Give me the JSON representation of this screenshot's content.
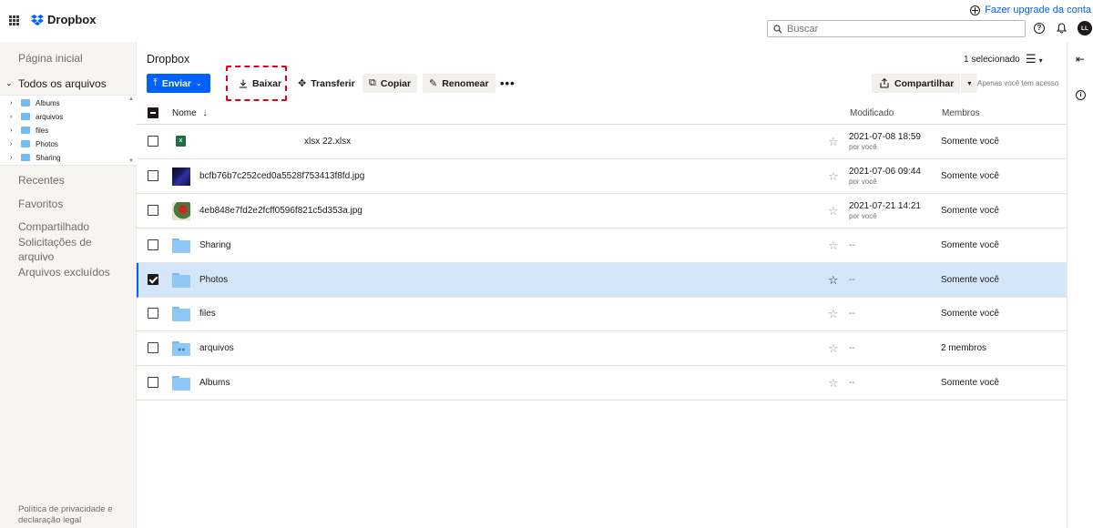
{
  "header": {
    "brand": "Dropbox",
    "upgrade_label": "Fazer upgrade da conta",
    "search_placeholder": "Buscar",
    "avatar_initials": "LL",
    "help_glyph": "?",
    "accent_color": "#0061fe"
  },
  "sidebar": {
    "home": "Página inicial",
    "all_files": "Todos os arquivos",
    "tree": [
      {
        "label": "Albums",
        "icon": "folder-icon"
      },
      {
        "label": "arquivos",
        "icon": "shared-folder-icon"
      },
      {
        "label": "files",
        "icon": "folder-icon"
      },
      {
        "label": "Photos",
        "icon": "folder-icon"
      },
      {
        "label": "Sharing",
        "icon": "folder-icon"
      }
    ],
    "recent": "Recentes",
    "favorites": "Favoritos",
    "shared": "Compartilhado",
    "file_requests": "Solicitações de arquivo",
    "deleted": "Arquivos excluídos",
    "footer": "Política de privacidade e declaração legal"
  },
  "main": {
    "breadcrumb": "Dropbox",
    "selected_count": "1 selecionado",
    "toolbar": {
      "upload": "Enviar",
      "download": "Baixar",
      "move": "Transferir",
      "copy": "Copiar",
      "rename": "Renomear",
      "more": "•••",
      "share": "Compartilhar",
      "access_note": "Apenas você tem acesso"
    },
    "columns": {
      "name": "Nome",
      "modified": "Modificado",
      "members": "Membros"
    },
    "rows": [
      {
        "name": "xlsx 22.xlsx",
        "type": "xlsx",
        "modified": "2021-07-08 18:59",
        "by": "por você",
        "members": "Somente você",
        "selected": false
      },
      {
        "name": "bcfb76b7c252ced0a5528f753413f8fd.jpg",
        "type": "image",
        "modified": "2021-07-06 09:44",
        "by": "por você",
        "members": "Somente você",
        "selected": false
      },
      {
        "name": "4eb848e7fd2e2fcff0596f821c5d353a.jpg",
        "type": "image",
        "modified": "2021-07-21 14:21",
        "by": "por você",
        "members": "Somente você",
        "selected": false
      },
      {
        "name": "Sharing",
        "type": "folder",
        "modified": "--",
        "members": "Somente você",
        "selected": false
      },
      {
        "name": "Photos",
        "type": "folder",
        "modified": "--",
        "members": "Somente você",
        "selected": true
      },
      {
        "name": "files",
        "type": "folder",
        "modified": "--",
        "members": "Somente você",
        "selected": false
      },
      {
        "name": "arquivos",
        "type": "shared-folder",
        "modified": "--",
        "members": "2 membros",
        "selected": false
      },
      {
        "name": "Albums",
        "type": "folder",
        "modified": "--",
        "members": "Somente você",
        "selected": false
      }
    ]
  }
}
